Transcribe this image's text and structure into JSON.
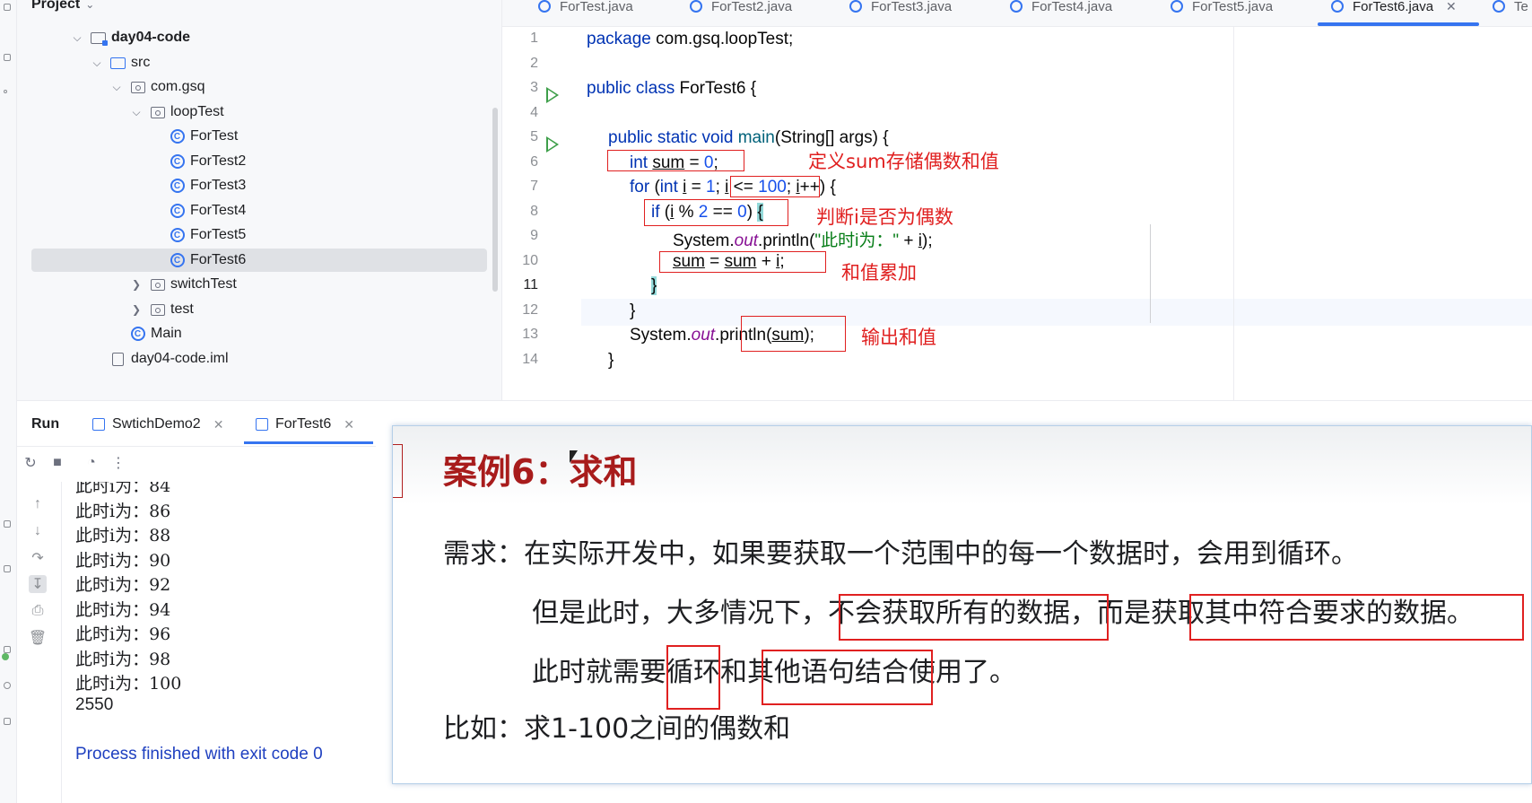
{
  "project": {
    "header": "Project",
    "tree": [
      {
        "label": "day04-code",
        "bold": true
      },
      {
        "label": "src"
      },
      {
        "label": "com.gsq"
      },
      {
        "label": "loopTest"
      },
      {
        "label": "ForTest"
      },
      {
        "label": "ForTest2"
      },
      {
        "label": "ForTest3"
      },
      {
        "label": "ForTest4"
      },
      {
        "label": "ForTest5"
      },
      {
        "label": "ForTest6",
        "selected": true
      },
      {
        "label": "switchTest"
      },
      {
        "label": "test"
      },
      {
        "label": "Main"
      },
      {
        "label": "day04-code.iml"
      }
    ]
  },
  "editor": {
    "tabs": [
      "ForTest.java",
      "ForTest2.java",
      "ForTest3.java",
      "ForTest4.java",
      "ForTest5.java",
      "ForTest6.java",
      "Te"
    ],
    "active_tab": "ForTest6.java",
    "line_numbers": [
      "1",
      "2",
      "3",
      "4",
      "5",
      "6",
      "7",
      "8",
      "9",
      "10",
      "11",
      "12",
      "13",
      "14"
    ],
    "current_line": "11",
    "code": {
      "l1_kw": "package ",
      "l1_rest": "com.gsq.loopTest;",
      "l3_kw": "public class ",
      "l3_rest": "ForTest6 {",
      "l5_kw": "public static void ",
      "l5_main": "main",
      "l5_rest": "(String[] args) {",
      "l6_kw": "int ",
      "l6_var": "sum",
      "l6_mid": " = ",
      "l6_num": "0",
      "l6_end": ";",
      "l7_for": "for ",
      "l7_a": "(",
      "l7_kw": "int ",
      "l7_i": "i",
      "l7_b": " = ",
      "l7_n1": "1",
      "l7_c": "; ",
      "l7_i2": "i",
      "l7_d": " <= ",
      "l7_n2": "100",
      "l7_e": "; ",
      "l7_i3": "i",
      "l7_f": "++) {",
      "l8_if": "if ",
      "l8_a": "(",
      "l8_i": "i",
      "l8_b": " % ",
      "l8_n1": "2",
      "l8_c": " == ",
      "l8_n2": "0",
      "l8_d": ") ",
      "l8_brace": "{",
      "l9_a": "System.",
      "l9_out": "out",
      "l9_b": ".println(",
      "l9_str": "\"此时i为：\"",
      "l9_c": " + ",
      "l9_i": "i",
      "l9_d": ");",
      "l10_sum1": "sum",
      "l10_a": " = ",
      "l10_sum2": "sum",
      "l10_b": " + ",
      "l10_i": "i",
      "l10_c": ";",
      "l11_brace": "}",
      "l12": "}",
      "l13_a": "System.",
      "l13_out": "out",
      "l13_b": ".println(",
      "l13_sum": "sum",
      "l13_c": ");",
      "l14": "}"
    },
    "annotations": {
      "sum_def": "定义sum存储偶数和值",
      "check_even": "判断i是否为偶数",
      "accumulate": "和值累加",
      "output": "输出和值"
    }
  },
  "run": {
    "title": "Run",
    "tabs": [
      "SwtichDemo2",
      "ForTest6"
    ],
    "output": [
      "此时i为：84",
      "此时i为：86",
      "此时i为：88",
      "此时i为：90",
      "此时i为：92",
      "此时i为：94",
      "此时i为：96",
      "此时i为：98",
      "此时i为：100",
      "2550",
      "",
      "Process finished with exit code 0"
    ]
  },
  "slide": {
    "title": "案例6：求和",
    "line1": "需求：在实际开发中，如果要获取一个范围中的每一个数据时，会用到循环。",
    "line2": "但是此时，大多情况下，不会获取所有的数据，而是获取其中符合要求的数据。",
    "line3": "此时就需要循环和其他语句结合使用了。",
    "line4": "比如：求1-100之间的偶数和"
  },
  "colors": {
    "keyword": "#0033b3",
    "number": "#1750eb",
    "string": "#067d17",
    "field": "#871094",
    "annotation_red": "#e02020",
    "slide_title": "#a81c1c",
    "accent_blue": "#3574f0"
  }
}
